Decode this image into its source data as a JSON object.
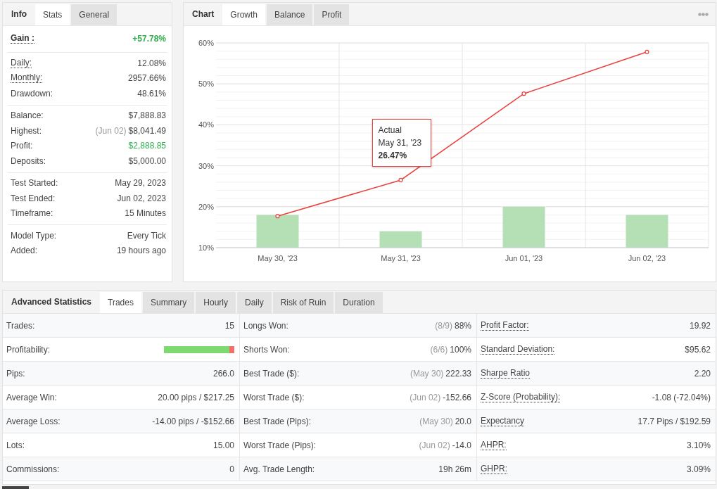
{
  "stats_panel": {
    "title": "Info",
    "tabs": [
      {
        "label": "Stats",
        "selected": true
      },
      {
        "label": "General",
        "selected": false
      }
    ],
    "sections": [
      {
        "rows": [
          {
            "label": "Gain :",
            "value": "+57.78%",
            "kind": "headline",
            "dotted": true,
            "positive": true
          }
        ]
      },
      {
        "rows": [
          {
            "label": "Daily:",
            "value": "12.08%",
            "kind": "plain",
            "dotted": true,
            "positive": false
          },
          {
            "label": "Monthly:",
            "value": "2957.66%",
            "kind": "plain",
            "dotted": true,
            "positive": false
          },
          {
            "label": "Drawdown:",
            "value": "48.61%",
            "kind": "plain",
            "dotted": false,
            "positive": false
          }
        ]
      },
      {
        "rows": [
          {
            "label": "Balance:",
            "value": "$7,888.83",
            "kind": "plain",
            "dotted": false,
            "positive": false
          },
          {
            "label": "Highest:",
            "note": "(Jun 02)",
            "value": "$8,041.49",
            "kind": "plain",
            "dotted": false,
            "positive": false
          },
          {
            "label": "Profit:",
            "value": "$2,888.85",
            "kind": "plain",
            "dotted": false,
            "positive": true
          },
          {
            "label": "Deposits:",
            "value": "$5,000.00",
            "kind": "plain",
            "dotted": false,
            "positive": false
          }
        ]
      },
      {
        "rows": [
          {
            "label": "Test Started:",
            "value": "May 29, 2023",
            "kind": "plain",
            "dotted": false,
            "positive": false
          },
          {
            "label": "Test Ended:",
            "value": "Jun 02, 2023",
            "kind": "plain",
            "dotted": false,
            "positive": false
          },
          {
            "label": "Timeframe:",
            "value": "15 Minutes",
            "kind": "plain",
            "dotted": false,
            "positive": false
          }
        ]
      },
      {
        "rows": [
          {
            "label": "Model Type:",
            "value": "Every Tick",
            "kind": "plain",
            "dotted": false,
            "positive": false
          },
          {
            "label": "Added:",
            "value": "19 hours ago",
            "kind": "plain",
            "dotted": false,
            "positive": false
          }
        ]
      }
    ]
  },
  "chart_panel": {
    "title": "Chart",
    "tabs": [
      {
        "label": "Growth",
        "selected": true
      },
      {
        "label": "Balance",
        "selected": false
      },
      {
        "label": "Profit",
        "selected": false
      }
    ],
    "tooltip": {
      "date": "May 31, '23",
      "value": "26.47%"
    },
    "chart_data": {
      "type": "line",
      "categories": [
        "May 30, '23",
        "May 31, '23",
        "Jun 01, '23",
        "Jun 02, '23"
      ],
      "ylim": [
        10,
        60
      ],
      "yticks": [
        {
          "value": 10,
          "label": "10%"
        },
        {
          "value": 20,
          "label": "20%"
        },
        {
          "value": 30,
          "label": "30%"
        },
        {
          "value": 40,
          "label": "40%"
        },
        {
          "value": 50,
          "label": "50%"
        },
        {
          "value": 60,
          "label": "60%"
        }
      ],
      "series": [
        {
          "type": "bar",
          "color": "#b5dfb5",
          "values": [
            18,
            14,
            20,
            18
          ]
        },
        {
          "name": "Actual",
          "color": "#e8413c",
          "marker": true,
          "values": [
            17.7,
            26.5,
            47.6,
            57.8
          ]
        }
      ],
      "grid": true
    }
  },
  "advanced_statistics": {
    "title": "Advanced Statistics",
    "tabs": [
      {
        "label": "Trades",
        "selected": true
      },
      {
        "label": "Summary",
        "selected": false
      },
      {
        "label": "Hourly",
        "selected": false
      },
      {
        "label": "Daily",
        "selected": false
      },
      {
        "label": "Risk of Ruin",
        "selected": false
      },
      {
        "label": "Duration",
        "selected": false
      }
    ],
    "columns": [
      {
        "rows": [
          {
            "kind": "text",
            "label": "Trades:",
            "value": "15"
          },
          {
            "kind": "bar",
            "label": "Profitability:",
            "level": 0.93
          },
          {
            "kind": "text",
            "label": "Pips:",
            "value": "266.0"
          },
          {
            "kind": "text",
            "label": "Average Win:",
            "value": "20.00 pips / $217.25"
          },
          {
            "kind": "text",
            "label": "Average Loss:",
            "value": "-14.00 pips / -$152.66"
          },
          {
            "kind": "text",
            "label": "Lots:",
            "value": "15.00"
          },
          {
            "kind": "text",
            "label": "Commissions:",
            "value": "0"
          }
        ]
      },
      {
        "rows": [
          {
            "kind": "text",
            "label": "Longs Won:",
            "note": "(8/9)",
            "value": "88%"
          },
          {
            "kind": "text",
            "label": "Shorts Won:",
            "note": "(6/6)",
            "value": "100%"
          },
          {
            "kind": "text",
            "label": "Best Trade ($):",
            "note": "(May 30)",
            "value": "222.33"
          },
          {
            "kind": "text",
            "label": "Worst Trade ($):",
            "note": "(Jun 02)",
            "value": "-152.66"
          },
          {
            "kind": "text",
            "label": "Best Trade (Pips):",
            "note": "(May 30)",
            "value": "20.0"
          },
          {
            "kind": "text",
            "label": "Worst Trade (Pips):",
            "note": "(Jun 02)",
            "value": "-14.0"
          },
          {
            "kind": "text",
            "label": "Avg. Trade Length:",
            "value": "19h 26m"
          }
        ]
      },
      {
        "rows": [
          {
            "kind": "text",
            "label": "Profit Factor:",
            "value": "19.92",
            "dotted": true
          },
          {
            "kind": "text",
            "label": "Standard Deviation:",
            "value": "$95.62",
            "dotted": true
          },
          {
            "kind": "text",
            "label": "Sharpe Ratio",
            "value": "2.20",
            "dotted": true
          },
          {
            "kind": "text",
            "label": "Z-Score (Probability):",
            "value": "-1.08 (-72.04%)",
            "dotted": true
          },
          {
            "kind": "text",
            "label": "Expectancy",
            "value": "17.7 Pips / $192.59",
            "dotted": true
          },
          {
            "kind": "text",
            "label": "AHPR:",
            "value": "3.10%",
            "dotted": true
          },
          {
            "kind": "text",
            "label": "GHPR:",
            "value": "3.09%",
            "dotted": true
          }
        ]
      }
    ]
  }
}
